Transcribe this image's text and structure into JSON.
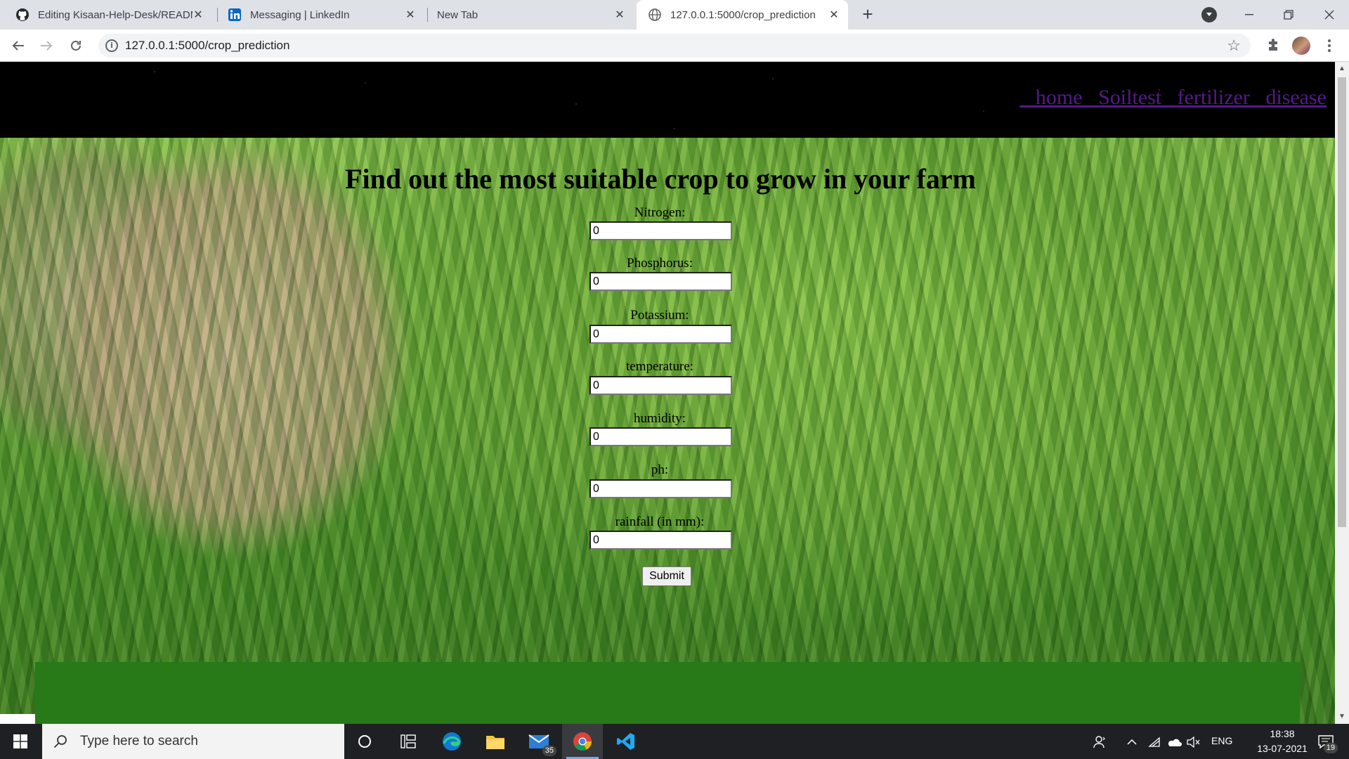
{
  "browser": {
    "tabs": [
      {
        "title": "Editing Kisaan-Help-Desk/READM",
        "icon": "github-icon",
        "active": false
      },
      {
        "title": "Messaging | LinkedIn",
        "icon": "linkedin-icon",
        "active": false
      },
      {
        "title": "New Tab",
        "icon": "",
        "active": false
      },
      {
        "title": "127.0.0.1:5000/crop_prediction",
        "icon": "globe-icon",
        "active": true
      }
    ],
    "url": "127.0.0.1:5000/crop_prediction"
  },
  "site": {
    "nav": [
      "home",
      "Soiltest",
      "fertilizer",
      "disease"
    ],
    "nav_color": "#551a8b",
    "header_bg": "#000000"
  },
  "form": {
    "title": "Find out the most suitable crop to grow in your farm",
    "fields": [
      {
        "label": "Nitrogen:",
        "value": "0"
      },
      {
        "label": "Phosphorus:",
        "value": "0"
      },
      {
        "label": "Potassium:",
        "value": "0"
      },
      {
        "label": "temperature:",
        "value": "0"
      },
      {
        "label": "humidity:",
        "value": "0"
      },
      {
        "label": "ph:",
        "value": "0"
      },
      {
        "label": "rainfall (in mm):",
        "value": "0"
      }
    ],
    "submit_label": "Submit"
  },
  "footer": {
    "band_color": "#277a17"
  },
  "taskbar": {
    "search_placeholder": "Type here to search",
    "mail_badge": "35",
    "language": "ENG",
    "time": "18:38",
    "date": "13-07-2021",
    "notifications": "19"
  }
}
